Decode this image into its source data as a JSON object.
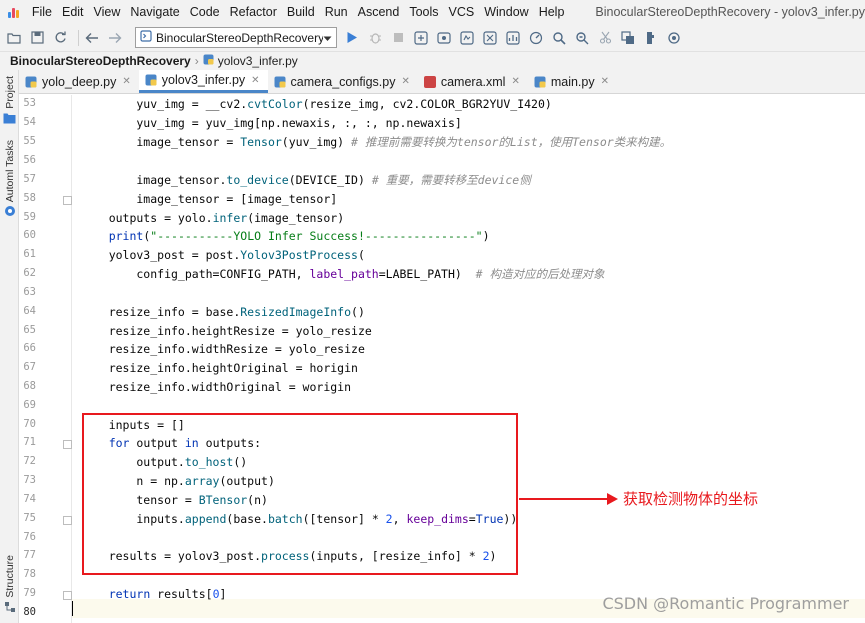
{
  "menubar": {
    "items": [
      "File",
      "Edit",
      "View",
      "Navigate",
      "Code",
      "Refactor",
      "Build",
      "Run",
      "Ascend",
      "Tools",
      "VCS",
      "Window",
      "Help"
    ],
    "window_title": "BinocularStereoDepthRecovery - yolov3_infer.py"
  },
  "toolbar": {
    "run_config": "BinocularStereoDepthRecovery"
  },
  "breadcrumb": {
    "project": "BinocularStereoDepthRecovery",
    "file": "yolov3_infer.py"
  },
  "side_panel": {
    "project_label": "Project",
    "automl_label": "Automl Tasks",
    "structure_label": "Structure"
  },
  "tabs": [
    {
      "label": "yolo_deep.py"
    },
    {
      "label": "yolov3_infer.py"
    },
    {
      "label": "camera_configs.py"
    },
    {
      "label": "camera.xml"
    },
    {
      "label": "main.py"
    }
  ],
  "editor": {
    "line_numbers": [
      "53",
      "54",
      "55",
      "56",
      "57",
      "58",
      "59",
      "60",
      "61",
      "62",
      "63",
      "64",
      "65",
      "66",
      "67",
      "68",
      "69",
      "70",
      "71",
      "72",
      "73",
      "74",
      "75",
      "76",
      "77",
      "78",
      "79",
      "80"
    ],
    "lines": [
      "        yuv_img = __cv2.cvtColor(resize_img, cv2.COLOR_BGR2YUV_I420)",
      "        yuv_img = yuv_img[np.newaxis, :, :, np.newaxis]",
      "        image_tensor = Tensor(yuv_img) # 推理前需要转换为tensor的List，使用Tensor类来构建。",
      "",
      "        image_tensor.to_device(DEVICE_ID) # 重要，需要转移至device侧",
      "        image_tensor = [image_tensor]",
      "    outputs = yolo.infer(image_tensor)",
      "    print(\"-----------YOLO Infer Success!----------------\")",
      "    yolov3_post = post.Yolov3PostProcess(",
      "        config_path=CONFIG_PATH, label_path=LABEL_PATH)  # 构造对应的后处理对象",
      "",
      "    resize_info = base.ResizedImageInfo()",
      "    resize_info.heightResize = yolo_resize",
      "    resize_info.widthResize = yolo_resize",
      "    resize_info.heightOriginal = horigin",
      "    resize_info.widthOriginal = worigin",
      "",
      "    inputs = []",
      "    for output in outputs:",
      "        output.to_host()",
      "        n = np.array(output)",
      "        tensor = BTensor(n)",
      "        inputs.append(base.batch([tensor] * 2, keep_dims=True))",
      "",
      "    results = yolov3_post.process(inputs, [resize_info] * 2)",
      "",
      "    return results[0]",
      ""
    ]
  },
  "annotation": {
    "text": "获取检测物体的坐标",
    "color": "#e8191e"
  },
  "watermark": "CSDN @Romantic Programmer"
}
